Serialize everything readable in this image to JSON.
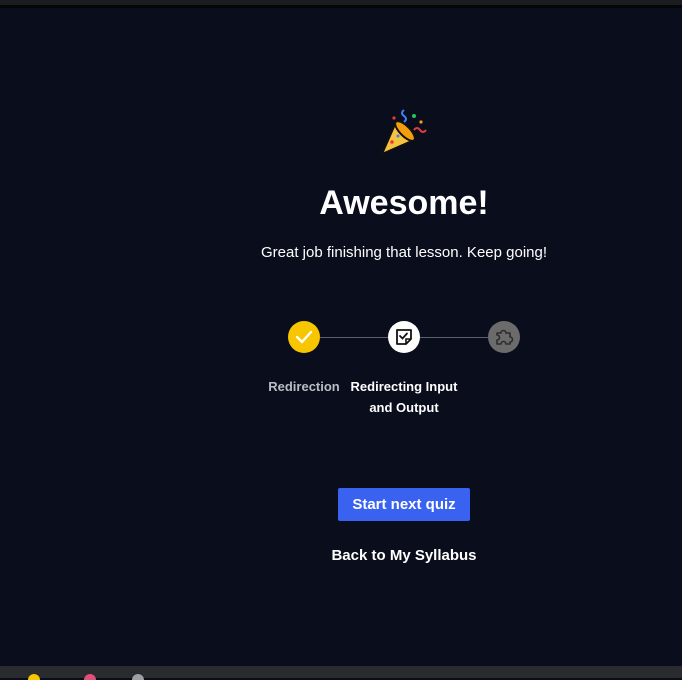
{
  "celebration": {
    "icon": "party-popper-icon"
  },
  "heading": {
    "title": "Awesome!",
    "message": "Great job finishing that lesson. Keep going!"
  },
  "progress": {
    "steps": [
      {
        "label": "Redirection",
        "state": "completed",
        "icon": "check-icon",
        "color": "#f7c600"
      },
      {
        "label": "Redirecting Input and Output",
        "state": "current",
        "icon": "quiz-icon",
        "color": "#ffffff"
      },
      {
        "label": "",
        "state": "locked",
        "icon": "puzzle-icon",
        "color": "#6b6b6b"
      }
    ]
  },
  "actions": {
    "start_next_quiz": "Start next quiz",
    "back_to_syllabus": "Back to My Syllabus"
  },
  "colors": {
    "background": "#0a0e1c",
    "accent": "#3a62f0"
  }
}
